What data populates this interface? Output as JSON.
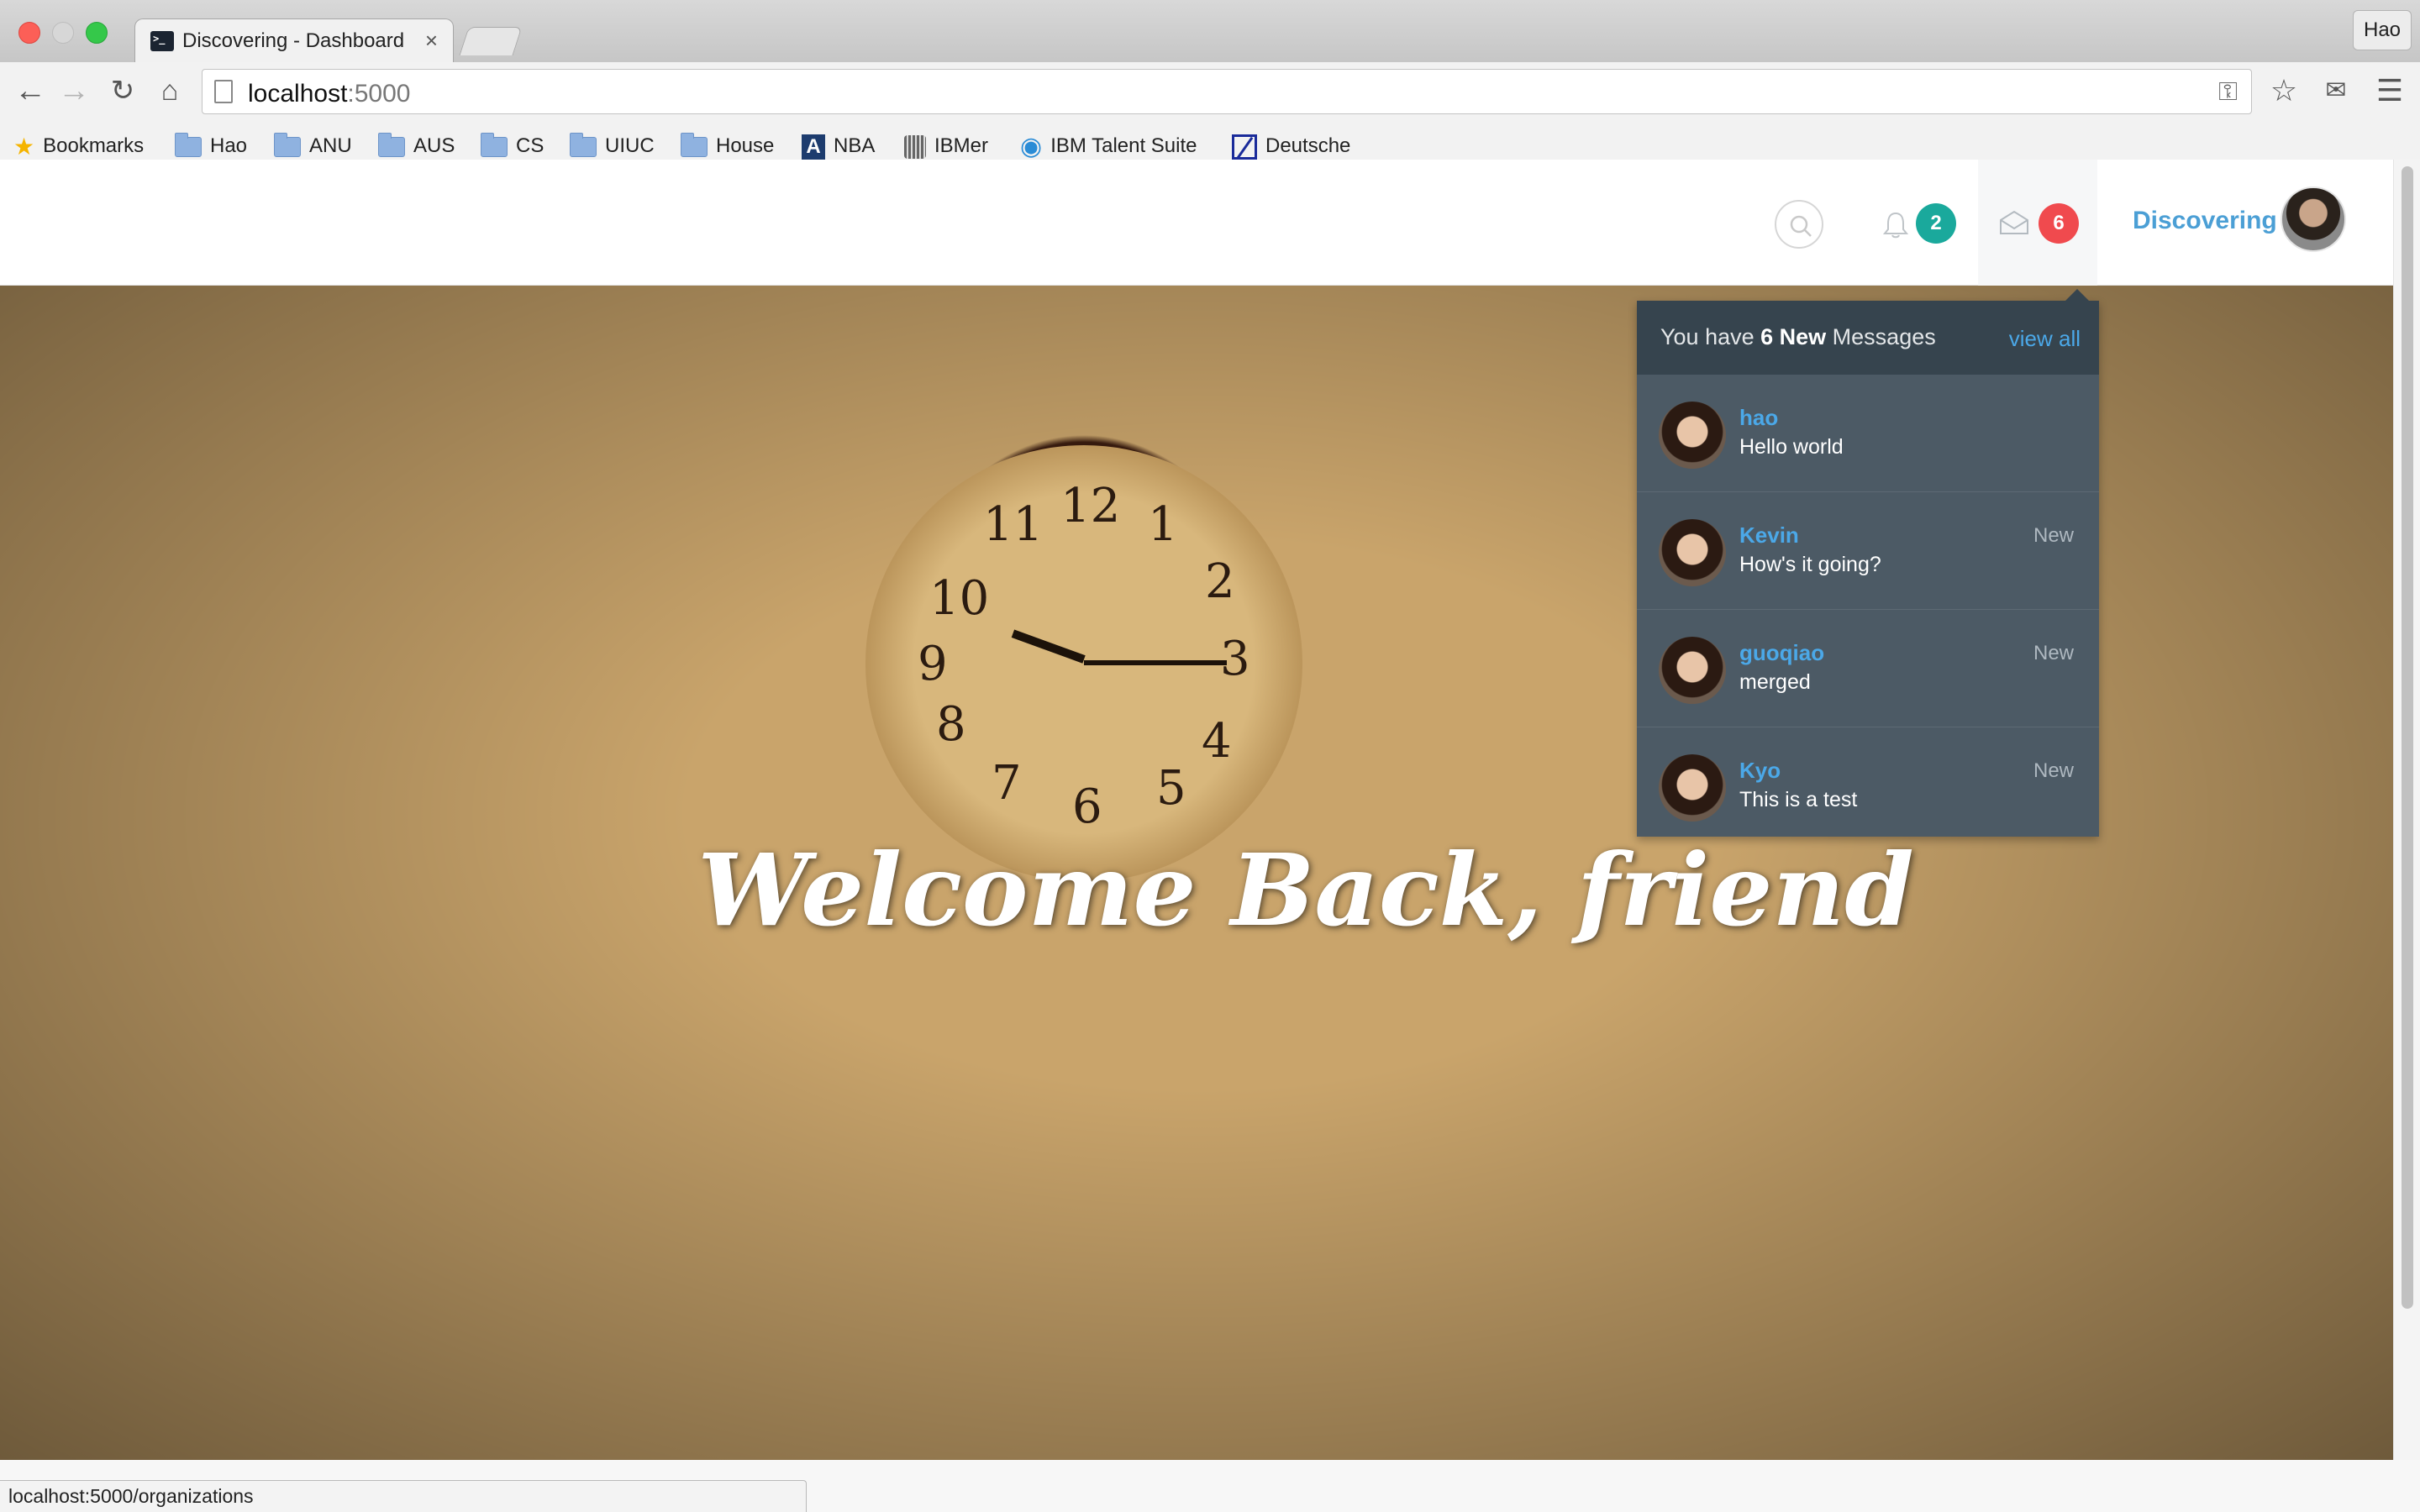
{
  "browser": {
    "tab_title": "Discovering - Dashboard",
    "tab_close": "×",
    "profile_name": "Hao",
    "url_host": "localhost",
    "url_port": ":5000",
    "bookmarks": [
      {
        "label": "Bookmarks",
        "icon": "star-icon"
      },
      {
        "label": "Hao",
        "icon": "folder-icon"
      },
      {
        "label": "ANU",
        "icon": "folder-icon"
      },
      {
        "label": "AUS",
        "icon": "folder-icon"
      },
      {
        "label": "CS",
        "icon": "folder-icon"
      },
      {
        "label": "UIUC",
        "icon": "folder-icon"
      },
      {
        "label": "House",
        "icon": "folder-icon"
      },
      {
        "label": "NBA",
        "icon": "nba-icon"
      },
      {
        "label": "IBMer",
        "icon": "ibmer-icon"
      },
      {
        "label": "IBM Talent Suite",
        "icon": "bulb-icon"
      },
      {
        "label": "Deutsche",
        "icon": "deutsche-icon"
      }
    ],
    "status_url": "localhost:5000/organizations"
  },
  "header": {
    "notifications_count": "2",
    "messages_count": "6",
    "user_name": "Discovering"
  },
  "hero": {
    "welcome_text": "Welcome Back, friend"
  },
  "messages": {
    "header_prefix": "You have ",
    "header_count": "6 New",
    "header_suffix": " Messages",
    "view_all": "view all",
    "items": [
      {
        "from": "hao",
        "text": "Hello world",
        "status": ""
      },
      {
        "from": "Kevin",
        "text": "How's it going?",
        "status": "New"
      },
      {
        "from": "guoqiao",
        "text": "merged",
        "status": "New"
      },
      {
        "from": "Kyo",
        "text": "This is a test",
        "status": "New"
      }
    ]
  },
  "colors": {
    "accent_blue": "#4ba8e8",
    "badge_teal": "#1aa99c",
    "badge_red": "#f04a4e",
    "dropdown_bg": "#4c5a65"
  }
}
